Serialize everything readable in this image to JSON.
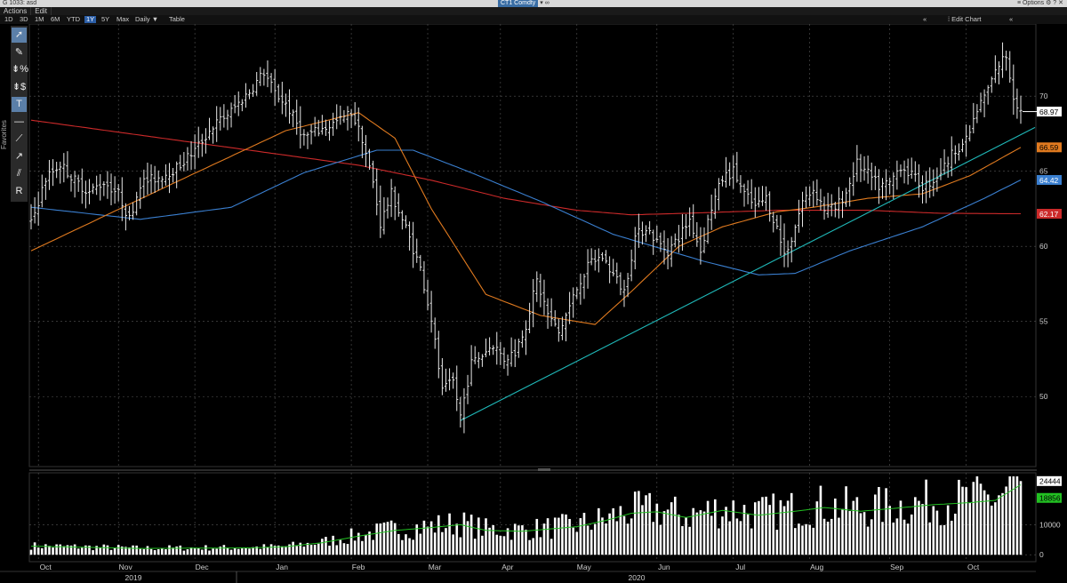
{
  "window": {
    "title": "G 1033: asd",
    "ticker": "CT1 Comdty",
    "link_icon": "link-icon",
    "options_label": "Options"
  },
  "menu": {
    "actions": "Actions",
    "edit": "Edit"
  },
  "range_buttons": [
    "1D",
    "3D",
    "1M",
    "6M",
    "YTD",
    "1Y",
    "5Y",
    "Max"
  ],
  "range_active": "1Y",
  "frequency": "Daily",
  "table_button": "Table",
  "edit_chart": "Edit Chart",
  "toolbar": {
    "favorites_label": "Favorites",
    "tools": [
      "cursor-icon",
      "pen-icon",
      "percent-measure-icon",
      "dollar-measure-icon",
      "text-tool-icon",
      "horizontal-line-icon",
      "trendline-icon",
      "ray-icon",
      "channel-icon",
      "reset-icon"
    ]
  },
  "colors": {
    "price_bars": "#e8e8e8",
    "ma_orange": "#e07a1f",
    "ma_blue": "#3a7fd0",
    "ma_red": "#cc2a2a",
    "trendline": "#1fb8b8",
    "volume_bars": "#ffffff",
    "volume_avg": "#22c022"
  },
  "chart_data": {
    "type": "bar",
    "price_axis": {
      "ticks": [
        50,
        55,
        60,
        65,
        70
      ],
      "ylim": [
        45.4,
        74.8
      ]
    },
    "price_labels": [
      {
        "value": 68.97,
        "label": "68.97",
        "color": "#ffffff",
        "text_color": "#000000"
      },
      {
        "value": 66.59,
        "label": "66.59",
        "color": "#e07a1f",
        "text_color": "#000000"
      },
      {
        "value": 64.42,
        "label": "64.42",
        "color": "#3a7fd0",
        "text_color": "#ffffff"
      },
      {
        "value": 62.17,
        "label": "62.17",
        "color": "#cc2a2a",
        "text_color": "#ffffff"
      }
    ],
    "volume_axis": {
      "ticks": [
        0,
        10000
      ],
      "ylim": [
        -2000,
        26600
      ]
    },
    "volume_labels": [
      {
        "value": 24444,
        "label": "24444",
        "color": "#ffffff",
        "text_color": "#000000"
      },
      {
        "value": 18856,
        "label": "18856",
        "color": "#22c022",
        "text_color": "#000000"
      }
    ],
    "x_months": [
      "Oct",
      "Nov",
      "Dec",
      "Jan",
      "Feb",
      "Mar",
      "Apr",
      "May",
      "Jun",
      "Jul",
      "Aug",
      "Sep",
      "Oct"
    ],
    "x_years": [
      "2019",
      "2020"
    ],
    "price_anchors": [
      [
        0,
        61.5
      ],
      [
        4,
        64.5
      ],
      [
        8,
        65.5
      ],
      [
        12,
        64.4
      ],
      [
        16,
        63.6
      ],
      [
        20,
        64.3
      ],
      [
        24,
        63.5
      ],
      [
        27,
        61.8
      ],
      [
        30,
        64.2
      ],
      [
        35,
        64.6
      ],
      [
        40,
        65.2
      ],
      [
        45,
        66.4
      ],
      [
        50,
        68.0
      ],
      [
        55,
        69.0
      ],
      [
        60,
        70.3
      ],
      [
        64,
        71.6
      ],
      [
        67,
        70.2
      ],
      [
        70,
        69.5
      ],
      [
        75,
        67.3
      ],
      [
        80,
        67.8
      ],
      [
        85,
        68.4
      ],
      [
        88,
        68.9
      ],
      [
        91,
        67.2
      ],
      [
        94,
        64.2
      ],
      [
        96,
        61.5
      ],
      [
        99,
        63.5
      ],
      [
        103,
        61.2
      ],
      [
        107,
        58.5
      ],
      [
        110,
        55.2
      ],
      [
        113,
        50.3
      ],
      [
        116,
        51.0
      ],
      [
        118,
        48.7
      ],
      [
        121,
        52.2
      ],
      [
        124,
        52.8
      ],
      [
        127,
        53.5
      ],
      [
        130,
        52.5
      ],
      [
        133,
        53.0
      ],
      [
        136,
        54.8
      ],
      [
        139,
        57.7
      ],
      [
        142,
        55.5
      ],
      [
        145,
        54.2
      ],
      [
        148,
        56.0
      ],
      [
        151,
        57.8
      ],
      [
        154,
        59.0
      ],
      [
        157,
        59.3
      ],
      [
        160,
        58.1
      ],
      [
        163,
        57.0
      ],
      [
        166,
        60.6
      ],
      [
        169,
        61.3
      ],
      [
        172,
        60.3
      ],
      [
        175,
        59.7
      ],
      [
        178,
        60.6
      ],
      [
        181,
        61.8
      ],
      [
        184,
        59.7
      ],
      [
        187,
        62.6
      ],
      [
        190,
        64.5
      ],
      [
        193,
        65.0
      ],
      [
        196,
        63.5
      ],
      [
        199,
        62.6
      ],
      [
        202,
        63.2
      ],
      [
        205,
        61.2
      ],
      [
        207,
        59.5
      ],
      [
        209,
        60.5
      ],
      [
        212,
        63.0
      ],
      [
        215,
        63.8
      ],
      [
        218,
        62.5
      ],
      [
        221,
        62.5
      ],
      [
        224,
        63.6
      ],
      [
        227,
        65.5
      ],
      [
        230,
        64.8
      ],
      [
        233,
        64.0
      ],
      [
        236,
        64.2
      ],
      [
        239,
        65.4
      ],
      [
        242,
        64.7
      ],
      [
        245,
        64.0
      ],
      [
        248,
        64.4
      ],
      [
        251,
        65.3
      ],
      [
        254,
        66.5
      ],
      [
        257,
        67.0
      ],
      [
        260,
        69.0
      ],
      [
        263,
        70.5
      ],
      [
        266,
        72.1
      ],
      [
        268,
        72.7
      ],
      [
        270,
        70.0
      ],
      [
        272,
        68.97
      ]
    ],
    "volume_anchors": [
      [
        0,
        3000
      ],
      [
        30,
        2200
      ],
      [
        60,
        2400
      ],
      [
        70,
        2800
      ],
      [
        80,
        4200
      ],
      [
        90,
        6500
      ],
      [
        100,
        8500
      ],
      [
        110,
        9500
      ],
      [
        118,
        10500
      ],
      [
        125,
        8500
      ],
      [
        135,
        8200
      ],
      [
        150,
        9800
      ],
      [
        158,
        12000
      ],
      [
        165,
        14500
      ],
      [
        172,
        15000
      ],
      [
        180,
        13000
      ],
      [
        190,
        15500
      ],
      [
        200,
        13800
      ],
      [
        210,
        15200
      ],
      [
        218,
        16500
      ],
      [
        228,
        15200
      ],
      [
        238,
        16300
      ],
      [
        248,
        17500
      ],
      [
        258,
        18200
      ],
      [
        265,
        19000
      ],
      [
        272,
        24444
      ]
    ],
    "ma_orange": [
      [
        0,
        59.7
      ],
      [
        40,
        64.3
      ],
      [
        70,
        67.7
      ],
      [
        90,
        68.9
      ],
      [
        100,
        67.2
      ],
      [
        110,
        62.5
      ],
      [
        125,
        56.8
      ],
      [
        140,
        55.4
      ],
      [
        155,
        54.8
      ],
      [
        165,
        57.0
      ],
      [
        178,
        60.0
      ],
      [
        190,
        61.3
      ],
      [
        205,
        62.3
      ],
      [
        215,
        62.6
      ],
      [
        230,
        63.2
      ],
      [
        245,
        63.5
      ],
      [
        258,
        64.7
      ],
      [
        272,
        66.59
      ]
    ],
    "ma_blue": [
      [
        0,
        62.6
      ],
      [
        30,
        61.8
      ],
      [
        55,
        62.6
      ],
      [
        75,
        64.9
      ],
      [
        95,
        66.4
      ],
      [
        105,
        66.4
      ],
      [
        120,
        65.0
      ],
      [
        140,
        63.0
      ],
      [
        160,
        60.8
      ],
      [
        185,
        59.0
      ],
      [
        200,
        58.1
      ],
      [
        210,
        58.2
      ],
      [
        225,
        59.7
      ],
      [
        245,
        61.3
      ],
      [
        262,
        63.2
      ],
      [
        272,
        64.42
      ]
    ],
    "ma_red": [
      [
        0,
        68.4
      ],
      [
        30,
        67.4
      ],
      [
        60,
        66.4
      ],
      [
        90,
        65.4
      ],
      [
        110,
        64.4
      ],
      [
        130,
        63.2
      ],
      [
        150,
        62.4
      ],
      [
        165,
        62.1
      ],
      [
        180,
        62.2
      ],
      [
        205,
        62.4
      ],
      [
        230,
        62.4
      ],
      [
        250,
        62.2
      ],
      [
        272,
        62.17
      ]
    ],
    "trendline": [
      [
        118,
        48.4
      ],
      [
        262,
        66.2
      ],
      [
        272,
        67.5
      ]
    ]
  }
}
